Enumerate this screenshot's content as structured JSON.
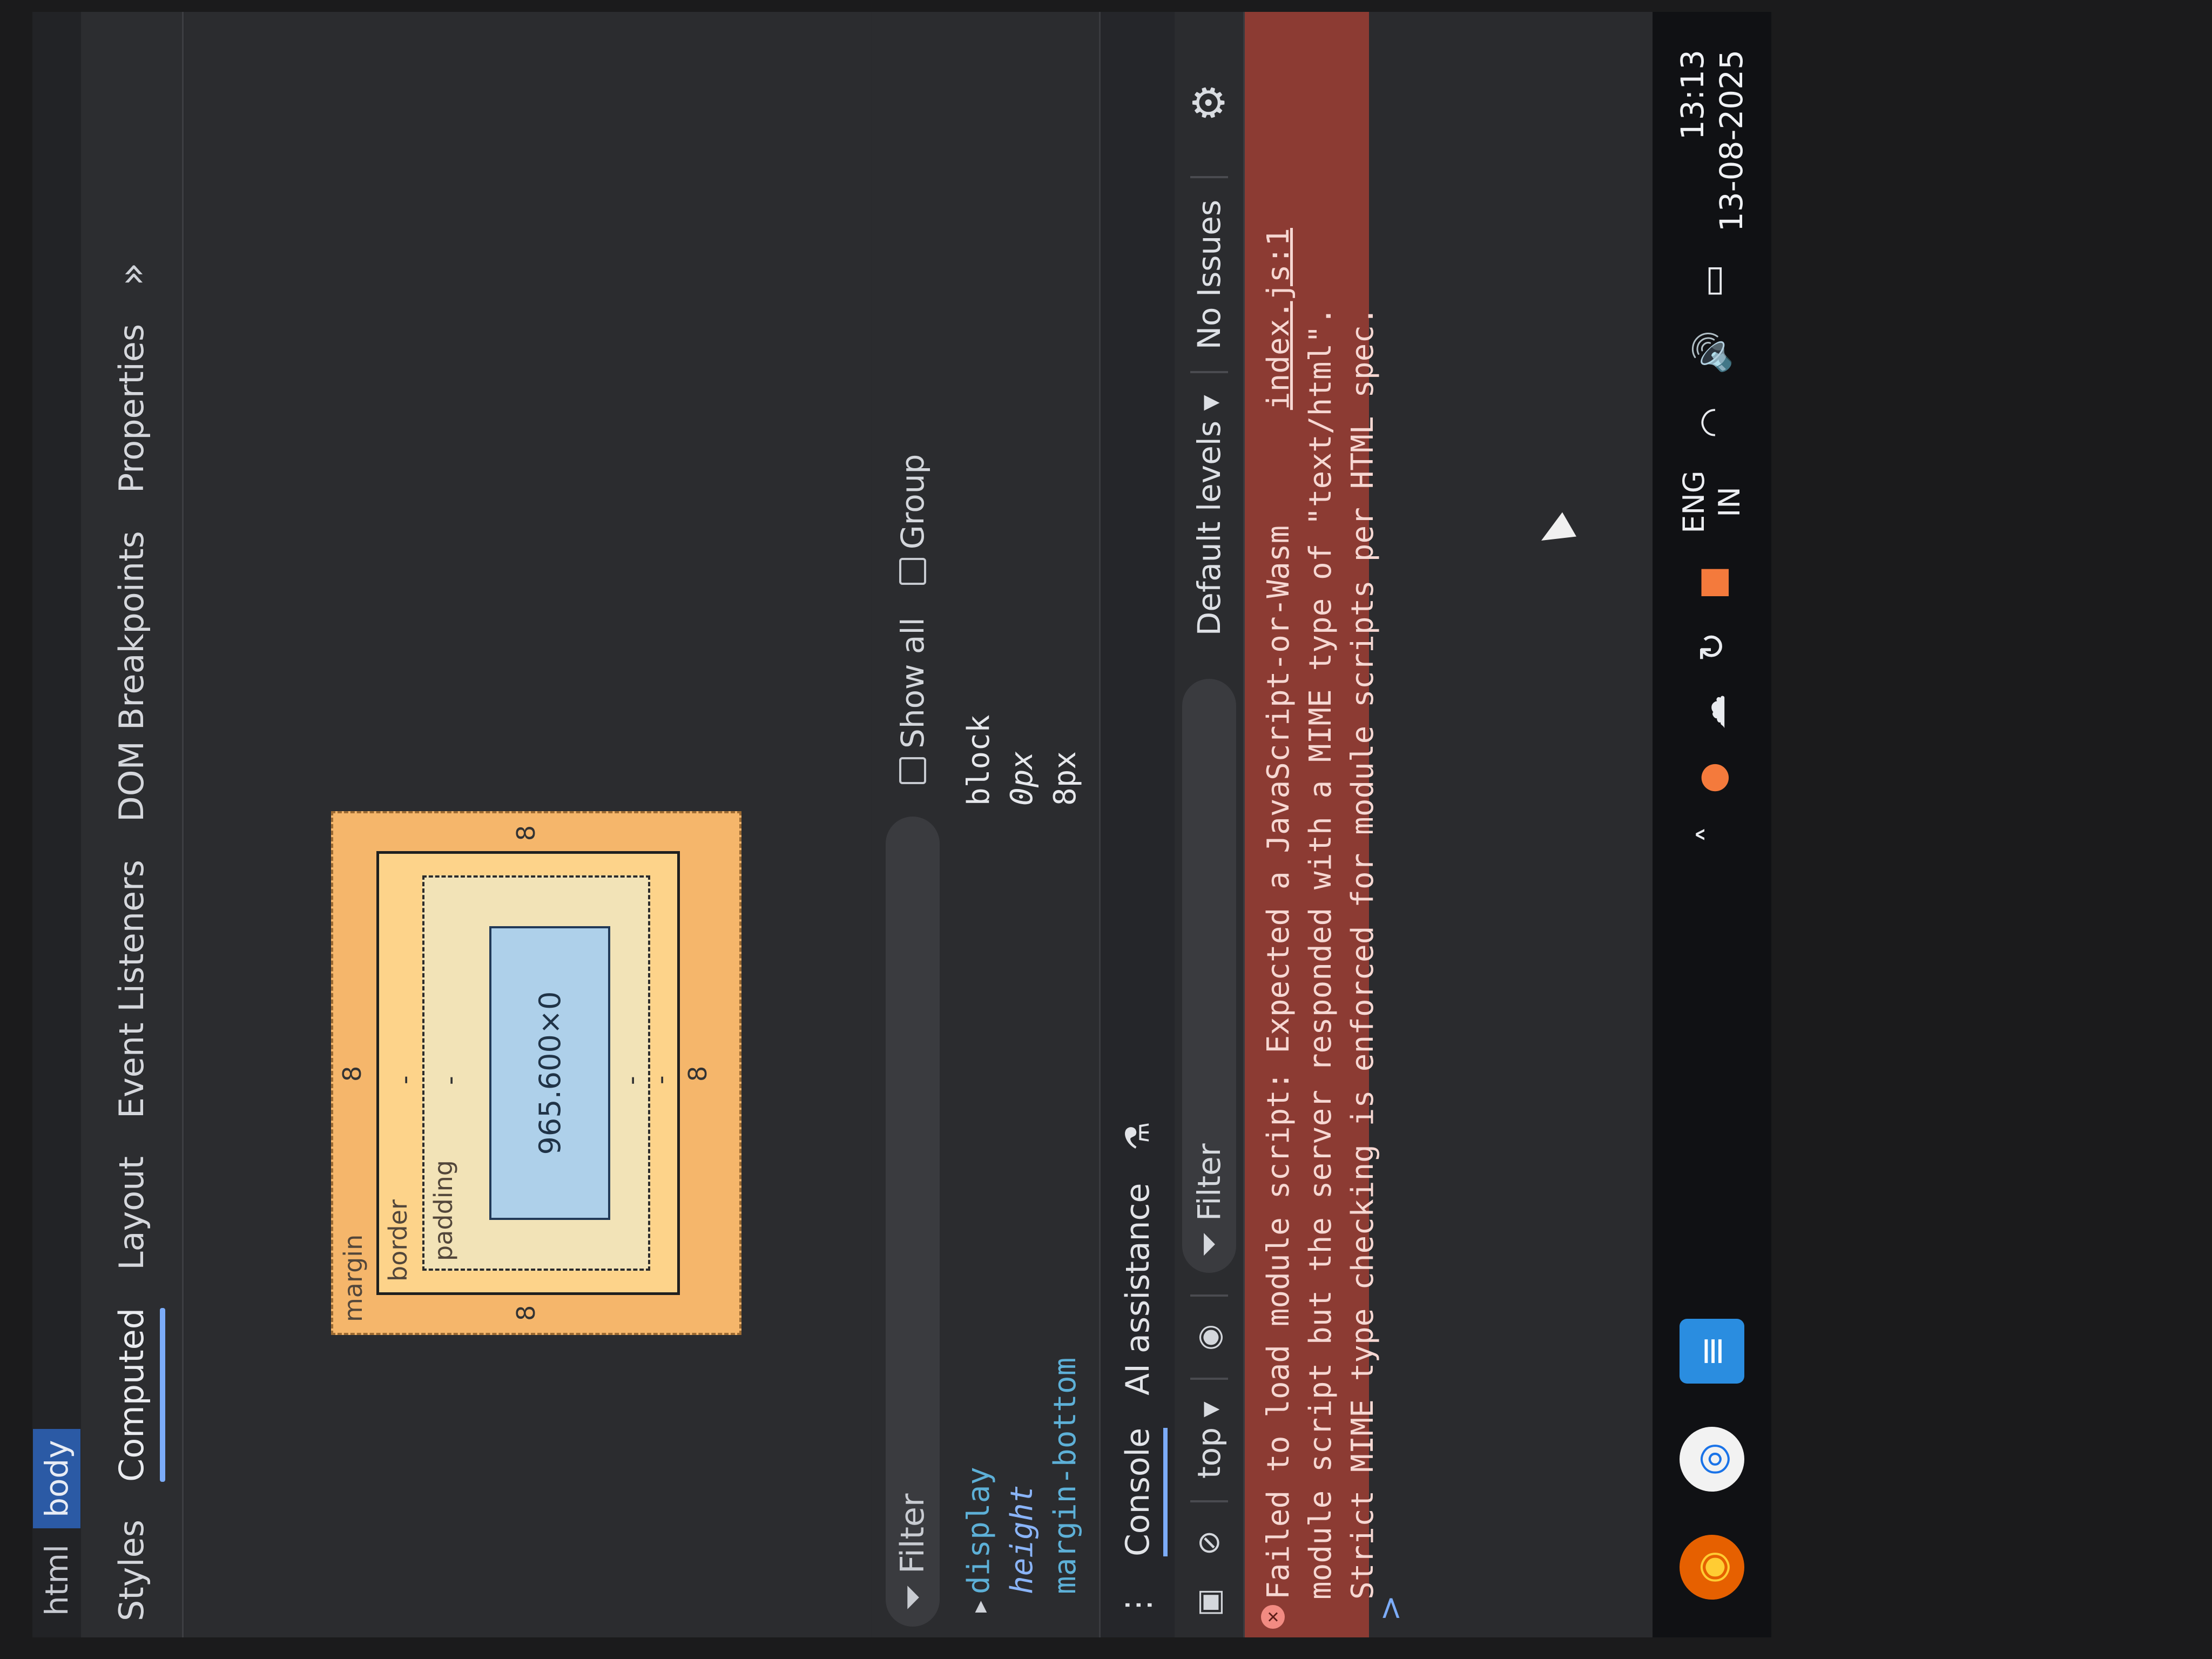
{
  "breadcrumb": [
    "html",
    "body"
  ],
  "panel_tabs": [
    "Styles",
    "Computed",
    "Layout",
    "Event Listeners",
    "DOM Breakpoints",
    "Properties"
  ],
  "panel_tabs_more": "»",
  "box_model": {
    "margin_label": "margin",
    "border_label": "border",
    "padding_label": "padding",
    "content_size": "965.600×0",
    "margin_top": "8",
    "margin_bottom": "8",
    "margin_left": "8",
    "margin_right": "8",
    "border_value": "-",
    "padding_value": "-"
  },
  "computed_filter": {
    "placeholder": "Filter",
    "show_all": "Show all",
    "group": "Group"
  },
  "computed_props": [
    {
      "name": "display",
      "value": "block"
    },
    {
      "name": "height",
      "value": "0px"
    },
    {
      "name": "margin-bottom",
      "value": "8px"
    }
  ],
  "console_tabs": [
    "Console",
    "AI assistance"
  ],
  "console_toolbar": {
    "context": "top",
    "filter_placeholder": "Filter",
    "levels": "Default levels",
    "issues": "No Issues"
  },
  "console_error": {
    "source": "index.js:1",
    "lines": [
      "Failed to load module script: Expected a JavaScript-or-Wasm",
      "module script but the server responded with a MIME type of \"text/html\".",
      "Strict MIME type checking is enforced for module scripts per HTML spec."
    ]
  },
  "console_prompt": ">",
  "taskbar": {
    "language_line1": "ENG",
    "language_line2": "IN",
    "time": "13:13",
    "date": "13-08-2025"
  },
  "icons": {
    "error": "error-circle-icon",
    "gear": "gear-icon",
    "eye": "eye-icon",
    "clear": "clear-console-icon",
    "sidebar": "sidebar-toggle-icon"
  }
}
